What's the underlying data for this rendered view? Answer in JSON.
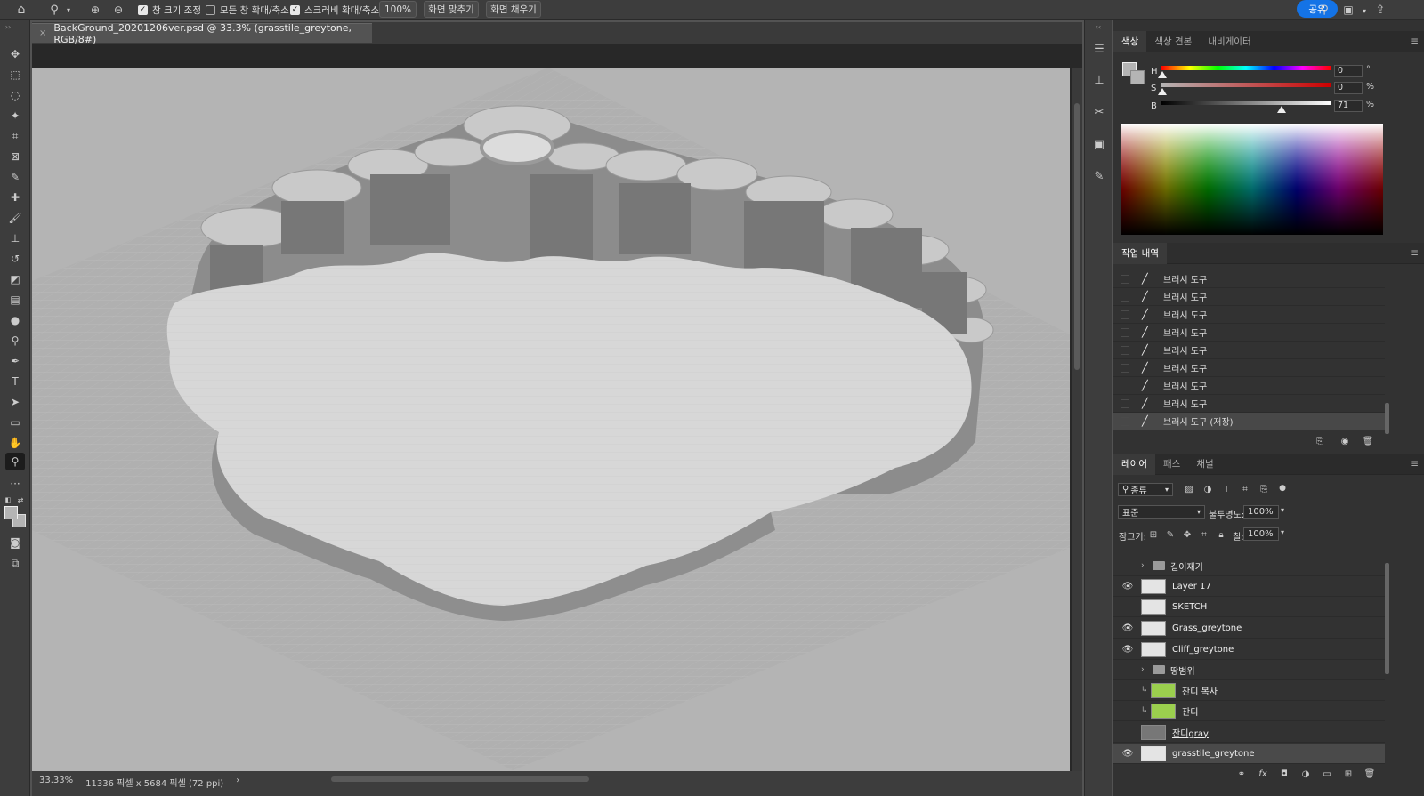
{
  "options_bar": {
    "resize_windows": "창 크기 조정",
    "zoom_all_windows": "모든 창 확대/축소",
    "scrubby_zoom": "스크러비 확대/축소",
    "zoom_level": "100%",
    "fit_screen": "화면 맞추기",
    "fill_screen": "화면 채우기",
    "share": "공유"
  },
  "document": {
    "tab_title": "BackGround_20201206ver.psd @ 33.3% (grasstile_greytone, RGB/8#)",
    "status_zoom": "33.33%",
    "status_info": "11336 픽셀 x 5684 픽셀 (72 ppi)"
  },
  "color_panel": {
    "tabs": [
      "색상",
      "색상 견본",
      "내비게이터"
    ],
    "h_label": "H",
    "h_value": "0",
    "h_unit": "°",
    "s_label": "S",
    "s_value": "0",
    "s_unit": "%",
    "b_label": "B",
    "b_value": "71",
    "b_unit": "%",
    "brightness_fraction": 0.71
  },
  "history_panel": {
    "title": "작업 내역",
    "items": [
      "브러시 도구",
      "브러시 도구",
      "브러시 도구",
      "브러시 도구",
      "브러시 도구",
      "브러시 도구",
      "브러시 도구",
      "브러시 도구",
      "브러시 도구 (저장)"
    ]
  },
  "layers_panel": {
    "tabs": [
      "레이어",
      "패스",
      "채널"
    ],
    "filter_kind": "종류",
    "blend_mode": "표준",
    "opacity_label": "불투명도:",
    "opacity_value": "100%",
    "lock_label": "잠그기:",
    "fill_label": "칠:",
    "fill_value": "100%",
    "layers": [
      "길이재기",
      "Layer 17",
      "SKETCH",
      "Grass_greytone",
      "Cliff_greytone",
      "땅범위",
      "잔디 복사",
      "잔디",
      "잔디gray",
      "grasstile_greytone"
    ]
  },
  "colors": {
    "accent": "#1473e6",
    "canvas": "#b4b4b4",
    "panel": "#323232"
  }
}
